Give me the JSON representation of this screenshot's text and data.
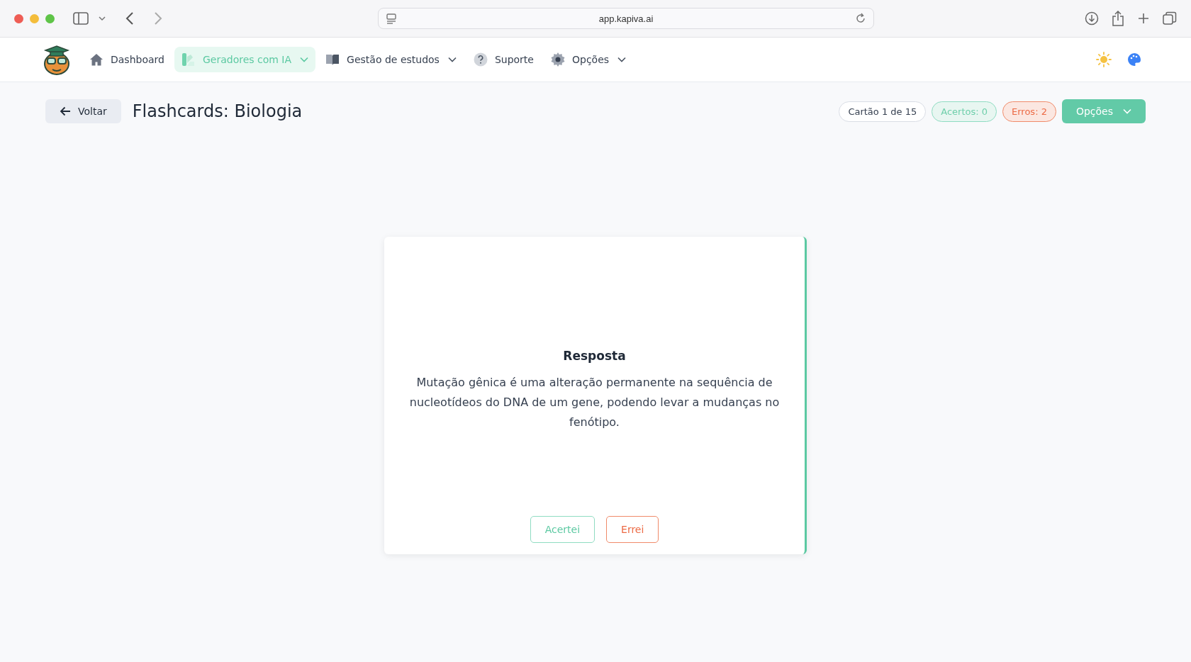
{
  "browser": {
    "url": "app.kapiva.ai"
  },
  "nav": {
    "items": [
      {
        "label": "Dashboard",
        "kind": "home",
        "selected": false,
        "dropdown": false
      },
      {
        "label": "Geradores com IA",
        "kind": "swatch",
        "selected": true,
        "dropdown": true
      },
      {
        "label": "Gestão de estudos",
        "kind": "book",
        "selected": false,
        "dropdown": true
      },
      {
        "label": "Suporte",
        "kind": "help",
        "selected": false,
        "dropdown": false
      },
      {
        "label": "Opções",
        "kind": "gear",
        "selected": false,
        "dropdown": true
      }
    ]
  },
  "header": {
    "back_button": "Voltar",
    "title": "Flashcards: Biologia",
    "badges": [
      {
        "label": "Cartão 1 de 15",
        "kind": "neutral"
      },
      {
        "label": "Acertos: 0",
        "kind": "success"
      },
      {
        "label": "Erros: 2",
        "kind": "error"
      }
    ],
    "options_button": "Opções"
  },
  "card": {
    "heading": "Resposta",
    "text": "Mutação gênica é uma alteração permanente na sequência de nucleotídeos do DNA de um gene, podendo levar a mudanças no fenótipo.",
    "buttons": [
      {
        "label": "Acertei",
        "kind": "success"
      },
      {
        "label": "Errei",
        "kind": "error"
      }
    ]
  }
}
